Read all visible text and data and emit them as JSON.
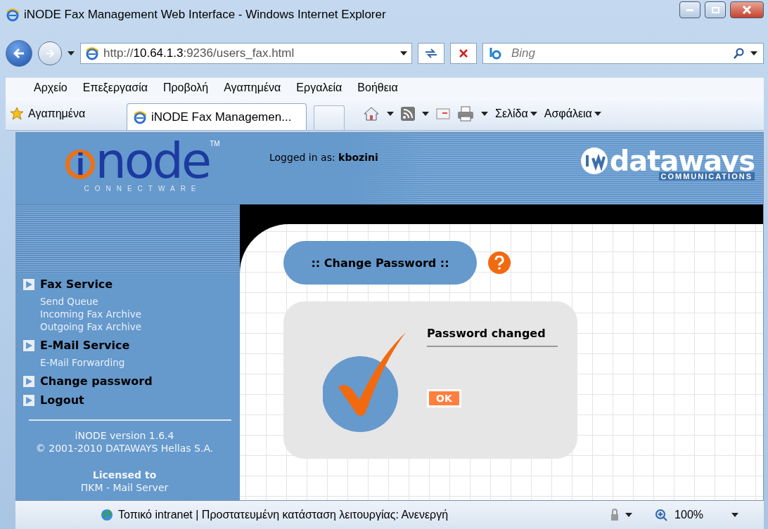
{
  "window": {
    "title": "iNODE Fax Management Web Interface - Windows Internet Explorer"
  },
  "address_bar": {
    "url": "http://**10.64.1.3**:9236/users_fax.html"
  },
  "search": {
    "placeholder": "Bing"
  },
  "menu": [
    "Αρχείο",
    "Επεξεργασία",
    "Προβολή",
    "Αγαπημένα",
    "Εργαλεία",
    "Βοήθεια"
  ],
  "favorites": {
    "label": "Αγαπημένα",
    "tabs": [
      {
        "label": "iNODE Fax Managemen...",
        "selected": true
      }
    ]
  },
  "command_bar": [
    "Σελίδα",
    "Ασφάλεια"
  ],
  "header": {
    "logo_mark": "i",
    "logo": "node",
    "logo_tm": "TM",
    "logo_sub": "CONNECTWARE",
    "logged_in_label": "Logged in as:",
    "user": "kbozini",
    "brand": "dataways",
    "brand_sub": "COMMUNICATIONS"
  },
  "sidebar": {
    "sections": [
      {
        "label": "Fax Service",
        "children": [
          "Send Queue",
          "Incoming Fax Archive",
          "Outgoing Fax Archive"
        ]
      },
      {
        "label": "E-Mail Service",
        "children": [
          "E-Mail Forwarding"
        ]
      },
      {
        "label": "Change password"
      },
      {
        "label": "Logout"
      }
    ],
    "version": "iNODE version 1.6.4",
    "copyright": "© 2001-2010 DATAWAYS Hellas S.A.",
    "licensed_label": "Licensed to",
    "licensee": "ΠΚΜ - Mail Server"
  },
  "content": {
    "title": ":: Change Password ::",
    "message": "Password changed",
    "ok": "OK"
  },
  "status_bar": {
    "zone": "Τοπικό intranet | Προστατευμένη κατάσταση λειτουργίας: Ανενεργή",
    "zoom": "100%"
  }
}
